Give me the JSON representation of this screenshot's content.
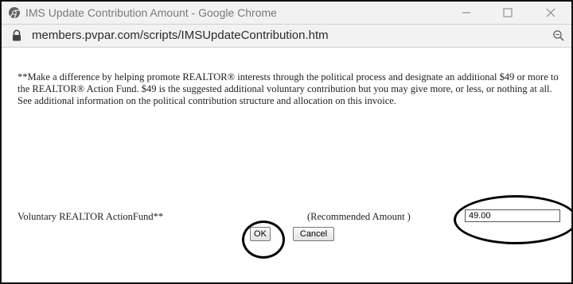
{
  "window": {
    "title": "IMS Update Contribution Amount - Google Chrome",
    "controls": [
      "minimize",
      "maximize",
      "close"
    ]
  },
  "address_bar": {
    "url": "members.pvpar.com/scripts/IMSUpdateContribution.htm"
  },
  "content": {
    "message": "**Make a difference by helping promote REALTOR® interests through the political process and designate an additional $49 or more to the REALTOR® Action Fund. $49 is the suggested additional voluntary contribution but you may give more, or less, or nothing at all. See additional information on the political contribution structure and allocation on this invoice.",
    "fund_label": "Voluntary REALTOR ActionFund**",
    "recommended_label": "(Recommended Amount )",
    "amount_value": "49.00",
    "ok_label": "OK",
    "cancel_label": "Cancel"
  },
  "icons": {
    "title_icon": "chrome-icon",
    "lock_icon": "lock-icon",
    "zoom_icon": "zoom-icon"
  },
  "colors": {
    "titlebar_bg": "#f2f2f2",
    "title_text": "#7a7a7a",
    "annotation": "#000000"
  }
}
